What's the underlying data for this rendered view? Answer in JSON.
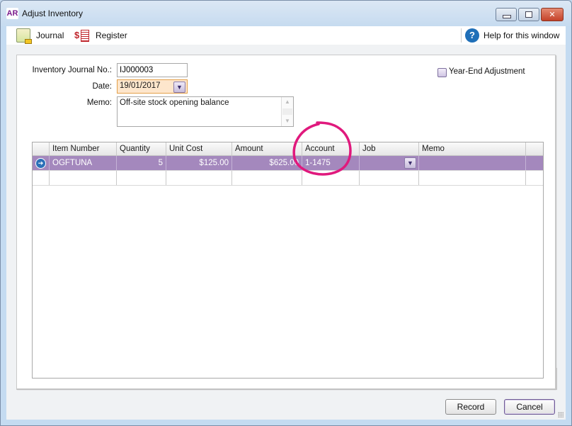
{
  "window": {
    "app_logo": "AR",
    "title": "Adjust Inventory",
    "controls": {
      "minimize": "minimize",
      "maximize": "maximize",
      "close": "✕"
    }
  },
  "toolbar": {
    "journal_label": "Journal",
    "register_label": "Register",
    "help_label": "Help for this window",
    "help_glyph": "?",
    "register_glyph": "$"
  },
  "form": {
    "journal_no_label": "Inventory Journal No.:",
    "journal_no_value": "IJ000003",
    "date_label": "Date:",
    "date_value": "19/01/2017",
    "memo_label": "Memo:",
    "memo_value": "Off-site stock opening balance",
    "year_end_label": "Year-End Adjustment",
    "year_end_checked": false
  },
  "grid": {
    "columns": [
      "",
      "Item Number",
      "Quantity",
      "Unit Cost",
      "Amount",
      "Account",
      "Job",
      "Memo",
      ""
    ],
    "rows": [
      {
        "selected": true,
        "indicator": "➔",
        "item_number": "OGFTUNA",
        "quantity": "5",
        "unit_cost": "$125.00",
        "amount": "$625.00",
        "account": "1-1475",
        "job": "",
        "memo": ""
      },
      {
        "selected": false,
        "indicator": "",
        "item_number": "",
        "quantity": "",
        "unit_cost": "",
        "amount": "",
        "account": "",
        "job": "",
        "memo": ""
      }
    ]
  },
  "annotation": {
    "highlight": "Account column",
    "color": "#e0197d"
  },
  "buttons": {
    "record": "Record",
    "cancel": "Cancel"
  },
  "colors": {
    "selected_row": "#a488bd",
    "date_field": "#fde6cc",
    "help_icon": "#1f6fb8"
  }
}
